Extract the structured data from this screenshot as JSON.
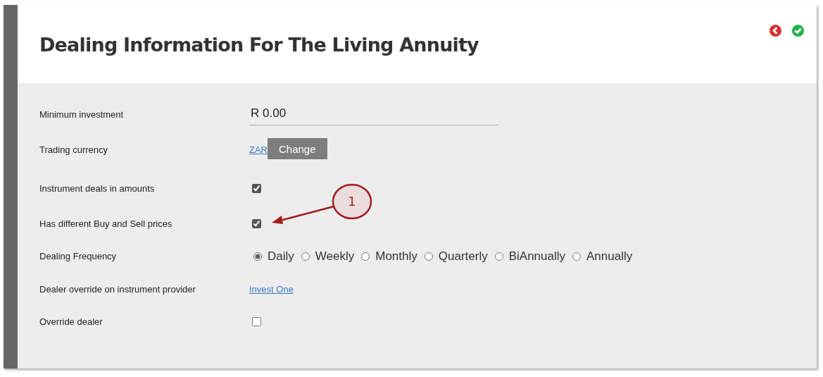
{
  "title": "Dealing Information For The Living Annuity",
  "fields": [
    {
      "kind": "text",
      "label": "Minimum investment",
      "value": "R 0.00"
    },
    {
      "kind": "currency",
      "label": "Trading currency",
      "link": "ZAR",
      "button": "Change"
    },
    {
      "kind": "checkbox",
      "label": "Instrument deals in amounts",
      "checked": true
    },
    {
      "kind": "checkbox",
      "label": "Has different Buy and Sell prices",
      "checked": true
    },
    {
      "kind": "radio",
      "label": "Dealing Frequency",
      "options": [
        {
          "label": "Daily",
          "selected": true
        },
        {
          "label": "Weekly",
          "selected": false
        },
        {
          "label": "Monthly",
          "selected": false
        },
        {
          "label": "Quarterly",
          "selected": false
        },
        {
          "label": "BiAnnually",
          "selected": false
        },
        {
          "label": "Annually",
          "selected": false
        }
      ]
    },
    {
      "kind": "link",
      "label": "Dealer override on instrument provider",
      "link": "Invest One"
    },
    {
      "kind": "checkbox",
      "label": "Override dealer",
      "checked": false
    }
  ],
  "annotation": {
    "label": "1"
  }
}
